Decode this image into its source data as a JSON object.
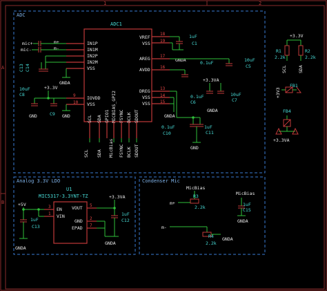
{
  "frame": {
    "col_marks": [
      "1",
      "2"
    ],
    "row_marks": [
      "A",
      "B"
    ]
  },
  "sections": {
    "adc": "ADC",
    "ldo": "Analog 3.3V LDO",
    "mic": "Condenser Mic"
  },
  "adc1": {
    "ref": "ADC1",
    "left_pins": [
      "IN1P",
      "IN1M",
      "IN2P",
      "IN2M",
      "VSS"
    ],
    "left_lower_pins": [
      "IOVDD",
      "VSS"
    ],
    "right_pins": [
      "VREF",
      "VSS",
      "AREG",
      "AVDD",
      "DREG",
      "VSS",
      "VSS"
    ],
    "right_pin_nums": [
      "18",
      "19",
      "17",
      "16",
      "13",
      "14",
      "15"
    ],
    "left_pin_nums": [
      "9",
      "10"
    ],
    "bottom_pins": [
      "SCL",
      "SDA",
      "GPIO1",
      "MICBIAS_GPI2",
      "FSYNC",
      "BCLK",
      "SDOUT"
    ],
    "bottom_nets": [
      "SCL",
      "SDA",
      "MicBias",
      "FSYNC",
      "BCLK",
      "SDOUT"
    ]
  },
  "mic_inputs": [
    "mic+",
    "mic-",
    "m+",
    "m-"
  ],
  "adc_parts": {
    "c_in1": "C13",
    "c_in2": "C14",
    "c1": {
      "ref": "C1",
      "value": "1uF"
    },
    "c5": {
      "ref": "C5",
      "value": "10uF"
    },
    "c6": {
      "ref": "C6",
      "value": "0.1uF"
    },
    "c7": {
      "ref": "C7",
      "value": "10uF"
    },
    "c8": {
      "ref": "C8",
      "value": "10uF"
    },
    "c9": {
      "ref": "C9",
      "value": "0.1uF"
    },
    "c10": {
      "ref": "C10",
      "value": "0.1uF"
    },
    "c11": {
      "ref": "C11",
      "value": "1uF"
    },
    "c4": {
      "ref": "C4",
      "value": "0.1uF"
    },
    "gnda_labels": [
      "GNDA",
      "GNDA",
      "GNDA",
      "GNDA",
      "GNDA"
    ],
    "gnd_labels": [
      "GND",
      "GND",
      "GND"
    ],
    "v33": [
      "+3.3V",
      "+3.3VA"
    ]
  },
  "right_parts": {
    "v33": "+3.3V",
    "r1": {
      "ref": "R1",
      "value": "2.2k"
    },
    "r2": {
      "ref": "R2",
      "value": "2.2k"
    },
    "scl": "SCL",
    "sda": "SDA",
    "v3v3": "+3V3",
    "fb1": "FB1",
    "fb4": "FB4",
    "v3v3a": "+3.3VA"
  },
  "ldo": {
    "ref": "U1",
    "part": "MIC5317-3.3YNT-TZ",
    "pins_left": [
      "EN",
      "VIN"
    ],
    "pins_right": [
      "VOUT",
      "GND",
      "EPAD"
    ],
    "pin_nums_left": [
      "3",
      "1"
    ],
    "pin_nums_right": [
      "5",
      "2",
      "7"
    ],
    "vin": "+5V",
    "vout": "+3.3VA",
    "c13": {
      "ref": "C13",
      "value": "1uF"
    },
    "c12": {
      "ref": "C12",
      "value": "1uF"
    },
    "gnda_left": "GNDA",
    "gnda_mid": "GNDA"
  },
  "mic": {
    "micbias_top": "MicBias",
    "micbias_right": "MicBias",
    "mplus": "m+",
    "mminus": "m-",
    "r3": {
      "ref": "R3",
      "value": "2.2k"
    },
    "r4": {
      "ref": "R4",
      "value": "2.2k"
    },
    "c15": {
      "ref": "C15",
      "value": "1uF"
    },
    "gnda1": "GNDA",
    "gnda2": "GNDA"
  }
}
